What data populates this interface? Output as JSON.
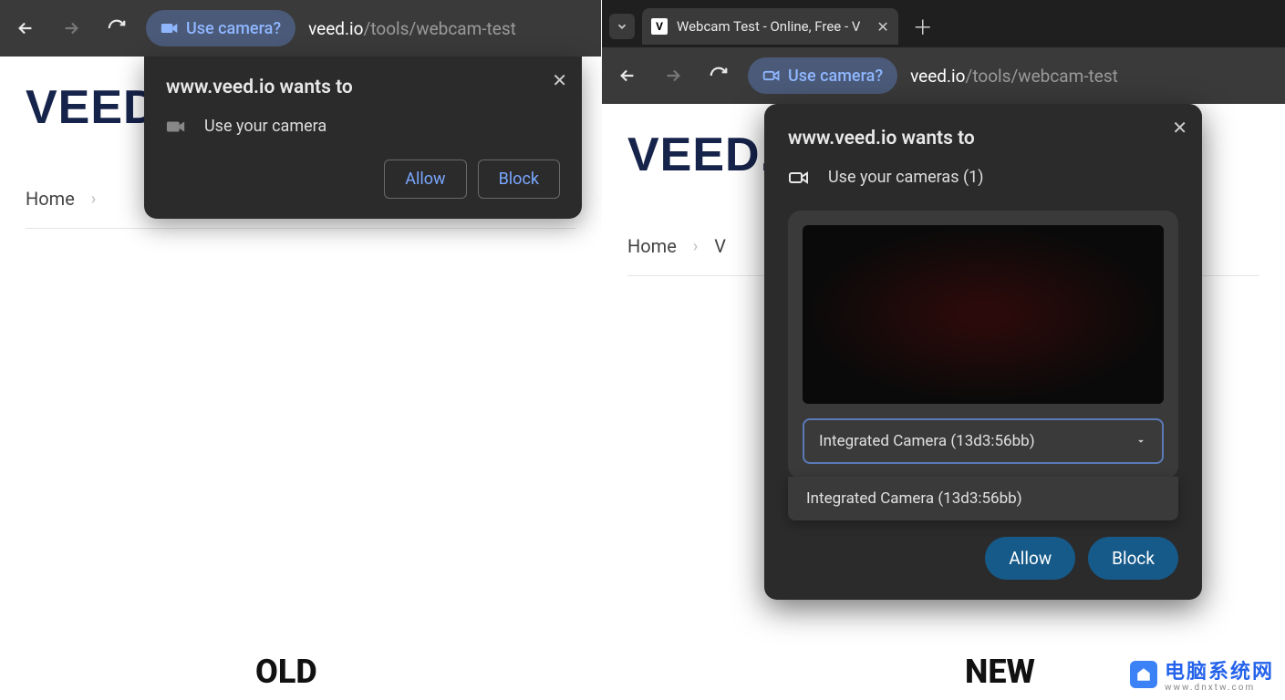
{
  "left": {
    "toolbar": {
      "chip_label": "Use camera?",
      "url_host": "veed.io",
      "url_path": "/tools/webcam-test"
    },
    "page": {
      "logo": "VEED.I",
      "crumb_home": "Home"
    },
    "popup": {
      "title": "www.veed.io wants to",
      "perm_label": "Use your camera",
      "allow": "Allow",
      "block": "Block"
    },
    "caption": "OLD"
  },
  "right": {
    "tab": {
      "favicon_letter": "V",
      "title": "Webcam Test - Online, Free - V"
    },
    "toolbar": {
      "chip_label": "Use camera?",
      "url_host": "veed.io",
      "url_path": "/tools/webcam-test"
    },
    "page": {
      "logo": "VEED.I",
      "crumb_home": "Home",
      "crumb_next_initial": "V"
    },
    "popup": {
      "title": "www.veed.io wants to",
      "perm_label": "Use your cameras (1)",
      "select_value": "Integrated Camera (13d3:56bb)",
      "option_0": "Integrated Camera (13d3:56bb)",
      "allow": "Allow",
      "block": "Block"
    },
    "caption": "NEW"
  },
  "watermark": {
    "line1": "电脑系统网",
    "line2": "www.dnxtw.com"
  }
}
